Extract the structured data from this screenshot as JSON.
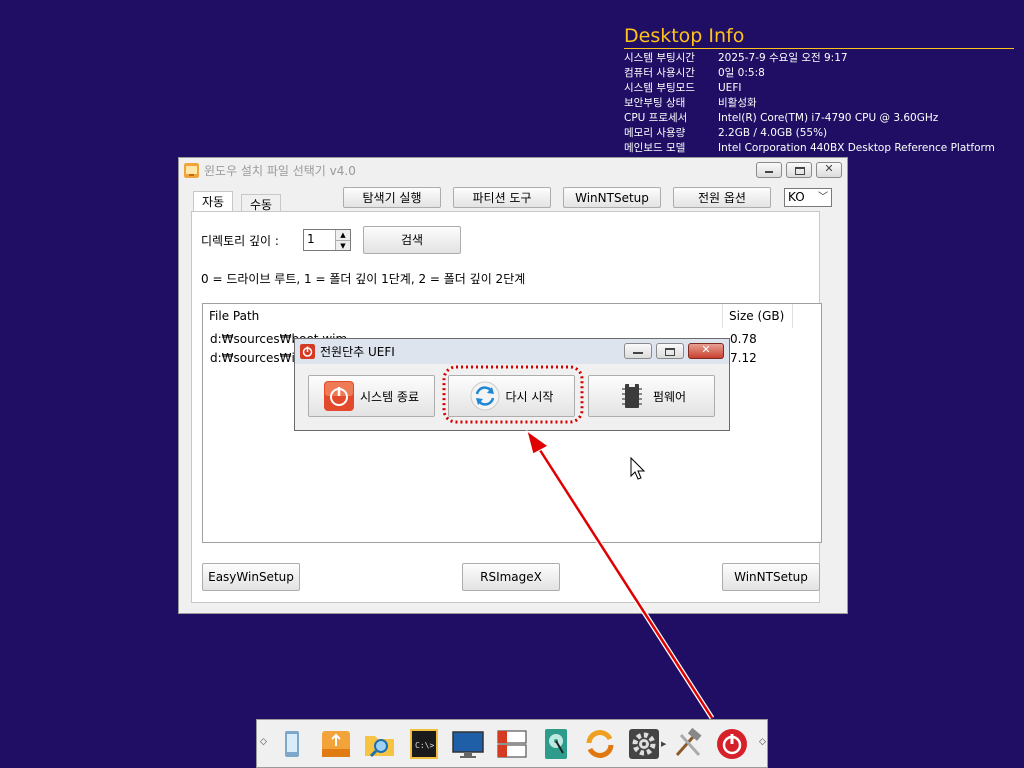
{
  "desktop_info": {
    "title": "Desktop Info",
    "rows": [
      {
        "label": "시스템 부팅시간",
        "value": "2025-7-9 수요일 오전 9:17"
      },
      {
        "label": "컴퓨터 사용시간",
        "value": "0일 0:5:8"
      },
      {
        "label": "시스템 부팅모드",
        "value": "UEFI"
      },
      {
        "label": "보안부팅 상태",
        "value": "비활성화"
      },
      {
        "label": "CPU 프로세서",
        "value": "Intel(R) Core(TM) i7-4790 CPU @ 3.60GHz"
      },
      {
        "label": "메모리 사용량",
        "value": "2.2GB / 4.0GB (55%)"
      },
      {
        "label": "메인보드 모델",
        "value": "Intel Corporation 440BX Desktop Reference Platform"
      }
    ]
  },
  "main_window": {
    "title": "윈도우 설치 파일 선택기 v4.0",
    "tabs": [
      {
        "label": "자동"
      },
      {
        "label": "수동"
      }
    ],
    "toolbar": {
      "explorer": "탐색기 실행",
      "partition": "파티션 도구",
      "winntsetup": "WinNTSetup",
      "power": "전원 옵션",
      "language": "KO"
    },
    "depth_label": "디렉토리 깊이 :",
    "depth_value": "1",
    "search_label": "검색",
    "hint": "0 = 드라이브 루트, 1 = 폴더 깊이 1단계, 2 = 폴더 깊이 2단계",
    "columns": {
      "path": "File Path",
      "size": "Size (GB)"
    },
    "rows": [
      {
        "path": "d:₩sources₩boot.wim",
        "size": "0.78"
      },
      {
        "path": "d:₩sources₩install.wim",
        "size": "7.12"
      }
    ],
    "bottom": {
      "easy": "EasyWinSetup",
      "rsimage": "RSImageX",
      "winnt": "WinNTSetup"
    }
  },
  "power_dialog": {
    "title": "전원단추  UEFI",
    "shutdown": "시스템 종료",
    "restart": "다시 시작",
    "firmware": "펌웨어"
  },
  "colors": {
    "desktop_bg": "#1f0e63",
    "info_title": "#ffc21c",
    "highlight": "#d40000"
  },
  "taskbar_icons": [
    "mobile-device-icon",
    "usb-drive-icon",
    "folder-search-icon",
    "command-prompt-icon",
    "monitor-icon",
    "drive-manager-icon",
    "hard-disk-icon",
    "sync-icon",
    "settings-gear-icon",
    "tools-icon",
    "power-icon"
  ]
}
